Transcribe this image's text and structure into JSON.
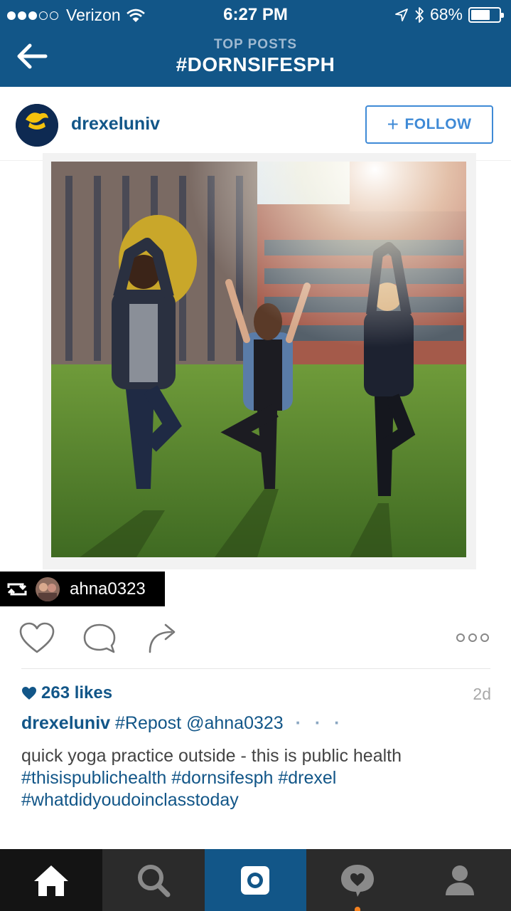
{
  "status_bar": {
    "carrier": "Verizon",
    "signal_bars_filled": 3,
    "signal_bars_total": 5,
    "time": "6:27 PM",
    "battery": "68%",
    "battery_level": 0.68
  },
  "nav": {
    "subtitle": "TOP POSTS",
    "title": "#DORNSIFESPH"
  },
  "post": {
    "username": "drexeluniv",
    "avatar_text": "Drexel",
    "follow_label": "FOLLOW",
    "repost_user": "ahna0323",
    "likes": "263 likes",
    "age": "2d",
    "caption_user": "drexeluniv",
    "caption_line1": "#Repost @ahna0323",
    "caption_more": "· · ·",
    "caption_text": "quick yoga practice outside - this is public health",
    "caption_tags": "#thisispublichealth #dornsifesph #drexel #whatdidyoudoinclasstoday"
  },
  "icons": {
    "back": "back-arrow-icon",
    "like": "heart-outline-icon",
    "comment": "comment-bubble-icon",
    "share": "share-arrow-icon",
    "options": "more-options-icon",
    "repost": "repost-icon"
  },
  "tabs": [
    {
      "name": "home",
      "icon": "home-icon"
    },
    {
      "name": "explore",
      "icon": "search-icon"
    },
    {
      "name": "camera",
      "icon": "camera-icon"
    },
    {
      "name": "activity",
      "icon": "activity-heart-icon"
    },
    {
      "name": "profile",
      "icon": "profile-icon"
    }
  ],
  "colors": {
    "brand_blue": "#125688",
    "follow_blue": "#3f8ad6",
    "tabbar_dark": "#2b2b2b",
    "notification_orange": "#f58220"
  }
}
